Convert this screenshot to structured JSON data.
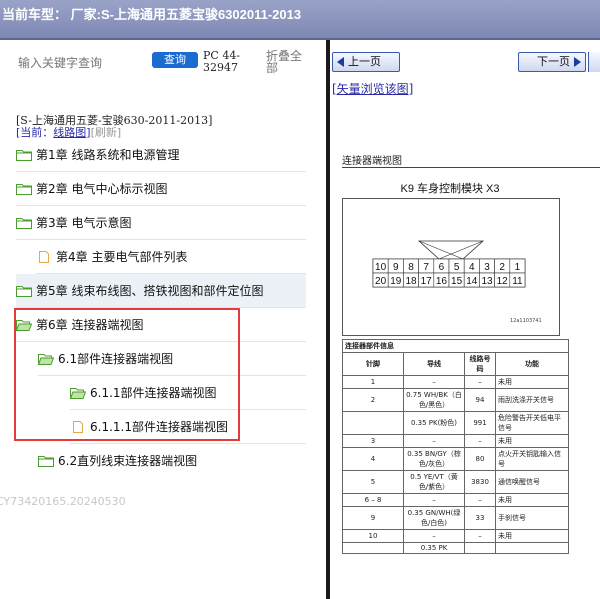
{
  "header": {
    "title": "当前车型：  厂家:S-上海通用五菱宝骏6302011-2013"
  },
  "search": {
    "placeholder": "输入关键字查询",
    "button_label": "查询",
    "pc_code": "PC 44-32947",
    "collapse_label": "折叠全部"
  },
  "tree": {
    "vehicle_title": "[S-上海通用五菱-宝骏630-2011-2013]",
    "current_label": "[当前：",
    "current_link": "线路图",
    "current_close": "]",
    "refresh_label": "[刷新]",
    "items": [
      {
        "label": "第1章 线路系统和电源管理",
        "icon": "folder-icon"
      },
      {
        "label": "第2章 电气中心标示视图",
        "icon": "folder-icon"
      },
      {
        "label": "第3章 电气示意图",
        "icon": "folder-icon"
      },
      {
        "label": "第4章 主要电气部件列表",
        "icon": "document-icon"
      },
      {
        "label": "第5章 线束布线图、搭铁视图和部件定位图",
        "icon": "folder-icon"
      },
      {
        "label": "第6章 连接器端视图",
        "icon": "folder-open-icon"
      },
      {
        "label": "6.1部件连接器端视图",
        "icon": "folder-open-icon"
      },
      {
        "label": "6.1.1部件连接器端视图",
        "icon": "folder-open-icon"
      },
      {
        "label": "6.1.1.1部件连接器端视图",
        "icon": "document-icon"
      },
      {
        "label": "6.2直列线束连接器端视图",
        "icon": "folder-icon"
      }
    ],
    "watermark": "CY73420165.20240530"
  },
  "viewer": {
    "prev_label": "上一页",
    "next_label": "下一页",
    "vector_link": "[矢量浏览该图]",
    "section_label": "连接器端视图",
    "diagram_title": "K9 车身控制模块 X3",
    "image_code": "12a1103741",
    "connector_top_row": [
      "10",
      "9",
      "8",
      "7",
      "6",
      "5",
      "4",
      "3",
      "2",
      "1"
    ],
    "connector_bottom_row": [
      "20",
      "19",
      "18",
      "17",
      "16",
      "15",
      "14",
      "13",
      "12",
      "11"
    ],
    "table": {
      "caption": "连接器部件信息",
      "headers": [
        "针脚",
        "导线",
        "线路号码",
        "功能"
      ],
      "rows": [
        [
          "1",
          "–",
          "–",
          "未用"
        ],
        [
          "2",
          "0.75 WH/BK（白色/黑色）",
          "94",
          "雨刮洗涤开关信号"
        ],
        [
          "",
          "0.35 PK(粉色)",
          "991",
          "危险警告开关低电平信号"
        ],
        [
          "3",
          "–",
          "–",
          "未用"
        ],
        [
          "4",
          "0.35 BN/GY（棕色/灰色）",
          "80",
          "点火开关钥匙输入信号"
        ],
        [
          "5",
          "0.5 YE/VT（黄色/紫色）",
          "3830",
          "通信唤醒信号"
        ],
        [
          "6 – 8",
          "–",
          "–",
          "未用"
        ],
        [
          "9",
          "0.35 GN/WH(绿色/白色)",
          "33",
          "手刹信号"
        ],
        [
          "10",
          "–",
          "–",
          "未用"
        ],
        [
          "",
          "0.35 PK",
          "",
          ""
        ]
      ]
    }
  },
  "colors": {
    "highlight_box": "#e23b3b",
    "folder_green": "#4a9e2e",
    "doc_orange": "#e8a64a",
    "link_blue": "#2a2aa8"
  }
}
